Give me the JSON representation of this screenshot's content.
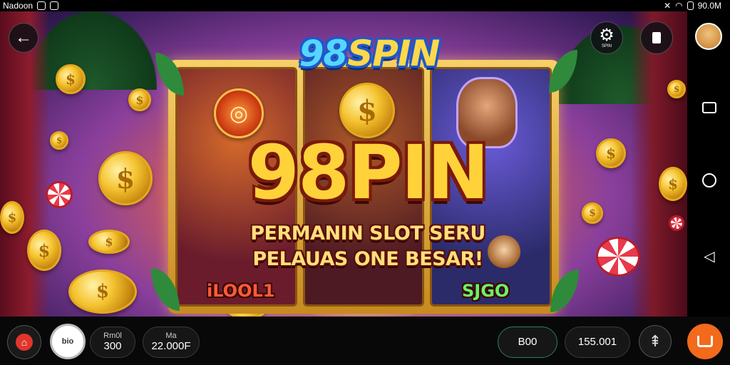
{
  "status_bar": {
    "left_text": "Nadoon",
    "right_text": "90.0M"
  },
  "game": {
    "brand_logo_num": "98",
    "brand_logo_word": "SPIN",
    "main_title": "98PIN",
    "subtitle_line1": "PERMANIN SLOT SERU",
    "subtitle_line2": "PELAUAS ONE BESAR!",
    "reel_labels": [
      "iLOOL1",
      "SJGO"
    ],
    "coin_symbol": "$",
    "settings_label": "SPIN"
  },
  "icons": {
    "back": "back-arrow-icon",
    "settings": "gear-icon",
    "info": "info-icon",
    "avatar": "avatar"
  },
  "bottom_bar": {
    "balance_label": "Rm0l",
    "balance_value": "300",
    "bet_label": "Ma",
    "bet_value": "22.000F",
    "pill_a_value": "B00",
    "pill_b_value": "155.001",
    "chip_label": "bio"
  },
  "colors": {
    "accent_orange": "#f26a1b",
    "pill_green_border": "#2f7d5a",
    "logo_blue": "#1f58c9",
    "title_gold": "#ffd23a"
  }
}
